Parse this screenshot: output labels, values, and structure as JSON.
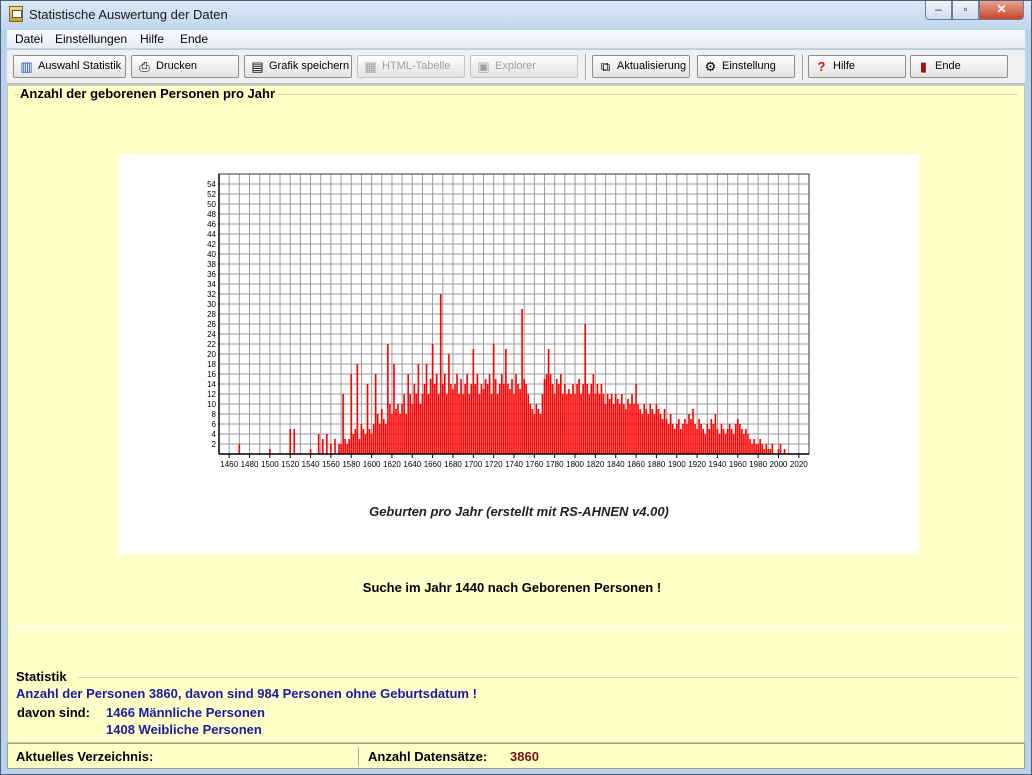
{
  "window": {
    "title": "Statistische Auswertung der Daten"
  },
  "menu": [
    "Datei",
    "Einstellungen",
    "Hilfe",
    "Ende"
  ],
  "toolbar": {
    "auswahl": "Auswahl Statistik",
    "drucken": "Drucken",
    "grafik": "Grafik speichern",
    "html": "HTML-Tabelle",
    "explorer": "Explorer",
    "aktualisierung": "Aktualisierung",
    "einstellung": "Einstellung",
    "hilfe": "Hilfe",
    "ende": "Ende"
  },
  "section": {
    "title": "Anzahl der geborenen Personen pro Jahr"
  },
  "chart_data": {
    "type": "bar",
    "title": "",
    "caption": "Geburten pro Jahr (erstellt mit RS-AHNEN v4.00)",
    "xlabel": "",
    "ylabel": "",
    "xlim": [
      1450,
      2030
    ],
    "ylim": [
      0,
      56
    ],
    "bar_color": "#ff0000",
    "grid": true,
    "x_ticks": [
      1460,
      1480,
      1500,
      1520,
      1540,
      1560,
      1580,
      1600,
      1620,
      1640,
      1660,
      1680,
      1700,
      1720,
      1740,
      1760,
      1780,
      1800,
      1820,
      1840,
      1860,
      1880,
      1900,
      1920,
      1940,
      1960,
      1980,
      2000,
      2020
    ],
    "y_ticks": [
      2,
      4,
      6,
      8,
      10,
      12,
      14,
      16,
      18,
      20,
      22,
      24,
      26,
      28,
      30,
      32,
      34,
      36,
      38,
      40,
      42,
      44,
      46,
      48,
      50,
      52,
      54
    ],
    "points": [
      [
        1470,
        2
      ],
      [
        1500,
        1
      ],
      [
        1520,
        5
      ],
      [
        1524,
        5
      ],
      [
        1540,
        1
      ],
      [
        1548,
        4
      ],
      [
        1552,
        3
      ],
      [
        1556,
        4
      ],
      [
        1560,
        2
      ],
      [
        1564,
        3
      ],
      [
        1568,
        2
      ],
      [
        1570,
        2
      ],
      [
        1572,
        12
      ],
      [
        1574,
        3
      ],
      [
        1576,
        2
      ],
      [
        1578,
        3
      ],
      [
        1580,
        16
      ],
      [
        1582,
        4
      ],
      [
        1584,
        5
      ],
      [
        1586,
        18
      ],
      [
        1588,
        3
      ],
      [
        1590,
        6
      ],
      [
        1592,
        5
      ],
      [
        1594,
        4
      ],
      [
        1596,
        14
      ],
      [
        1598,
        5
      ],
      [
        1600,
        4
      ],
      [
        1602,
        6
      ],
      [
        1604,
        16
      ],
      [
        1606,
        8
      ],
      [
        1608,
        6
      ],
      [
        1610,
        9
      ],
      [
        1612,
        7
      ],
      [
        1614,
        6
      ],
      [
        1616,
        22
      ],
      [
        1618,
        10
      ],
      [
        1620,
        8
      ],
      [
        1622,
        18
      ],
      [
        1624,
        9
      ],
      [
        1626,
        10
      ],
      [
        1628,
        8
      ],
      [
        1630,
        10
      ],
      [
        1632,
        12
      ],
      [
        1634,
        8
      ],
      [
        1636,
        16
      ],
      [
        1638,
        12
      ],
      [
        1640,
        10
      ],
      [
        1642,
        14
      ],
      [
        1644,
        12
      ],
      [
        1646,
        18
      ],
      [
        1648,
        10
      ],
      [
        1650,
        12
      ],
      [
        1652,
        14
      ],
      [
        1654,
        18
      ],
      [
        1656,
        12
      ],
      [
        1658,
        15
      ],
      [
        1660,
        22
      ],
      [
        1662,
        14
      ],
      [
        1664,
        16
      ],
      [
        1666,
        12
      ],
      [
        1668,
        32
      ],
      [
        1670,
        14
      ],
      [
        1672,
        16
      ],
      [
        1674,
        12
      ],
      [
        1676,
        20
      ],
      [
        1678,
        14
      ],
      [
        1680,
        13
      ],
      [
        1682,
        14
      ],
      [
        1684,
        16
      ],
      [
        1686,
        12
      ],
      [
        1688,
        15
      ],
      [
        1690,
        12
      ],
      [
        1692,
        14
      ],
      [
        1694,
        16
      ],
      [
        1696,
        12
      ],
      [
        1698,
        14
      ],
      [
        1700,
        21
      ],
      [
        1702,
        14
      ],
      [
        1704,
        16
      ],
      [
        1706,
        12
      ],
      [
        1708,
        14
      ],
      [
        1710,
        13
      ],
      [
        1712,
        15
      ],
      [
        1714,
        14
      ],
      [
        1716,
        16
      ],
      [
        1718,
        12
      ],
      [
        1720,
        22
      ],
      [
        1722,
        15
      ],
      [
        1724,
        12
      ],
      [
        1726,
        14
      ],
      [
        1728,
        16
      ],
      [
        1730,
        14
      ],
      [
        1732,
        21
      ],
      [
        1734,
        14
      ],
      [
        1736,
        13
      ],
      [
        1738,
        15
      ],
      [
        1740,
        12
      ],
      [
        1742,
        16
      ],
      [
        1744,
        14
      ],
      [
        1746,
        13
      ],
      [
        1748,
        29
      ],
      [
        1750,
        15
      ],
      [
        1752,
        14
      ],
      [
        1754,
        12
      ],
      [
        1756,
        10
      ],
      [
        1758,
        9
      ],
      [
        1760,
        8
      ],
      [
        1762,
        10
      ],
      [
        1764,
        9
      ],
      [
        1766,
        8
      ],
      [
        1768,
        12
      ],
      [
        1770,
        15
      ],
      [
        1772,
        16
      ],
      [
        1774,
        21
      ],
      [
        1776,
        16
      ],
      [
        1778,
        14
      ],
      [
        1780,
        12
      ],
      [
        1782,
        15
      ],
      [
        1784,
        14
      ],
      [
        1786,
        16
      ],
      [
        1788,
        12
      ],
      [
        1790,
        14
      ],
      [
        1792,
        12
      ],
      [
        1794,
        13
      ],
      [
        1796,
        12
      ],
      [
        1798,
        14
      ],
      [
        1800,
        12
      ],
      [
        1802,
        14
      ],
      [
        1804,
        15
      ],
      [
        1806,
        12
      ],
      [
        1808,
        14
      ],
      [
        1810,
        26
      ],
      [
        1812,
        14
      ],
      [
        1814,
        12
      ],
      [
        1816,
        14
      ],
      [
        1818,
        16
      ],
      [
        1820,
        12
      ],
      [
        1822,
        14
      ],
      [
        1824,
        12
      ],
      [
        1826,
        14
      ],
      [
        1828,
        12
      ],
      [
        1830,
        10
      ],
      [
        1832,
        12
      ],
      [
        1834,
        11
      ],
      [
        1836,
        12
      ],
      [
        1838,
        10
      ],
      [
        1840,
        12
      ],
      [
        1842,
        11
      ],
      [
        1844,
        10
      ],
      [
        1846,
        12
      ],
      [
        1848,
        10
      ],
      [
        1850,
        9
      ],
      [
        1852,
        11
      ],
      [
        1854,
        10
      ],
      [
        1856,
        12
      ],
      [
        1858,
        10
      ],
      [
        1860,
        14
      ],
      [
        1862,
        10
      ],
      [
        1864,
        9
      ],
      [
        1866,
        8
      ],
      [
        1868,
        10
      ],
      [
        1870,
        9
      ],
      [
        1872,
        8
      ],
      [
        1874,
        10
      ],
      [
        1876,
        9
      ],
      [
        1878,
        8
      ],
      [
        1880,
        10
      ],
      [
        1882,
        9
      ],
      [
        1884,
        8
      ],
      [
        1886,
        7
      ],
      [
        1888,
        9
      ],
      [
        1890,
        7
      ],
      [
        1892,
        6
      ],
      [
        1894,
        8
      ],
      [
        1896,
        6
      ],
      [
        1898,
        5
      ],
      [
        1900,
        6
      ],
      [
        1902,
        7
      ],
      [
        1904,
        5
      ],
      [
        1906,
        6
      ],
      [
        1908,
        7
      ],
      [
        1910,
        6
      ],
      [
        1912,
        8
      ],
      [
        1914,
        7
      ],
      [
        1916,
        9
      ],
      [
        1918,
        6
      ],
      [
        1920,
        5
      ],
      [
        1922,
        7
      ],
      [
        1924,
        6
      ],
      [
        1926,
        5
      ],
      [
        1928,
        4
      ],
      [
        1930,
        6
      ],
      [
        1932,
        5
      ],
      [
        1934,
        7
      ],
      [
        1936,
        6
      ],
      [
        1938,
        8
      ],
      [
        1940,
        5
      ],
      [
        1942,
        4
      ],
      [
        1944,
        6
      ],
      [
        1946,
        5
      ],
      [
        1948,
        4
      ],
      [
        1950,
        5
      ],
      [
        1952,
        6
      ],
      [
        1954,
        5
      ],
      [
        1956,
        4
      ],
      [
        1958,
        6
      ],
      [
        1960,
        7
      ],
      [
        1962,
        6
      ],
      [
        1964,
        5
      ],
      [
        1966,
        4
      ],
      [
        1968,
        5
      ],
      [
        1970,
        4
      ],
      [
        1972,
        3
      ],
      [
        1974,
        2
      ],
      [
        1976,
        3
      ],
      [
        1978,
        2
      ],
      [
        1980,
        2
      ],
      [
        1982,
        3
      ],
      [
        1984,
        2
      ],
      [
        1986,
        1
      ],
      [
        1988,
        2
      ],
      [
        1990,
        1
      ],
      [
        1992,
        1
      ],
      [
        1994,
        2
      ],
      [
        2000,
        1
      ],
      [
        2002,
        2
      ],
      [
        2006,
        1
      ]
    ]
  },
  "search_message": "Suche im Jahr 1440 nach Geborenen Personen !",
  "stats": {
    "title": "Statistik",
    "total": "Anzahl der Personen 3860, davon sind 984 Personen ohne Geburtsdatum !",
    "davon": "davon sind:",
    "male": "1466 Männliche Personen",
    "female": "1408 Weibliche Personen"
  },
  "status": {
    "dir_label": "Aktuelles Verzeichnis:",
    "count_label": "Anzahl Datensätze:",
    "count_value": "3860"
  }
}
